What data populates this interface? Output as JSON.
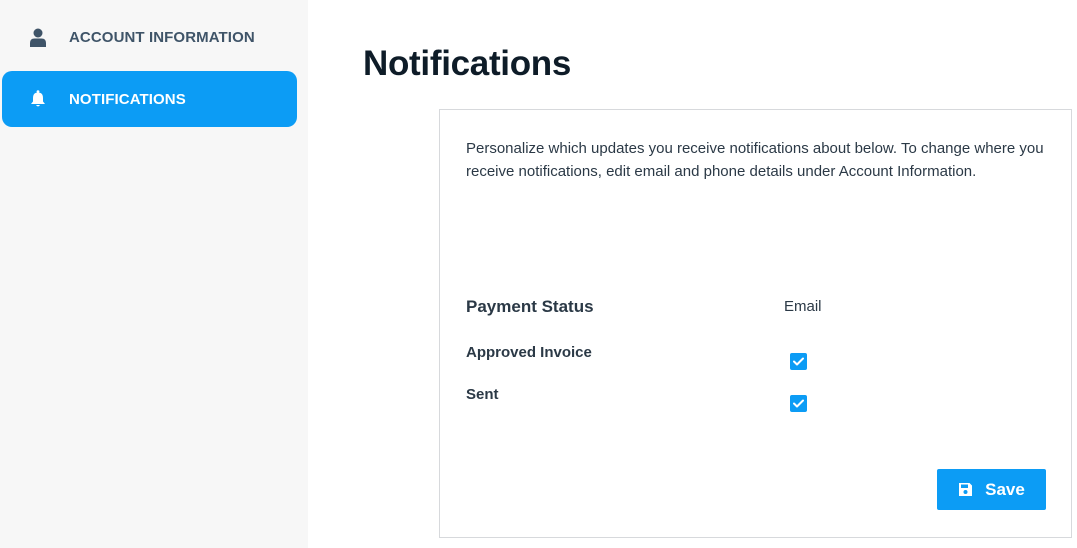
{
  "sidebar": {
    "items": [
      {
        "label": "ACCOUNT INFORMATION",
        "icon": "user-icon",
        "active": false
      },
      {
        "label": "NOTIFICATIONS",
        "icon": "bell-icon",
        "active": true
      }
    ]
  },
  "page": {
    "title": "Notifications"
  },
  "card": {
    "intro": "Personalize which updates you receive notifications about below. To change where you receive notifications, edit email and phone details under Account Information.",
    "section_heading": "Payment Status",
    "column_header": "Email",
    "rows": [
      {
        "label": "Approved Invoice",
        "email_checked": true
      },
      {
        "label": "Sent",
        "email_checked": true
      }
    ],
    "save_label": "Save",
    "save_icon": "floppy-disk-icon"
  },
  "colors": {
    "accent": "#0c9cf5",
    "sidebar_bg": "#f7f7f7",
    "sidebar_text": "#3f5468",
    "title_text": "#0e1c28"
  }
}
